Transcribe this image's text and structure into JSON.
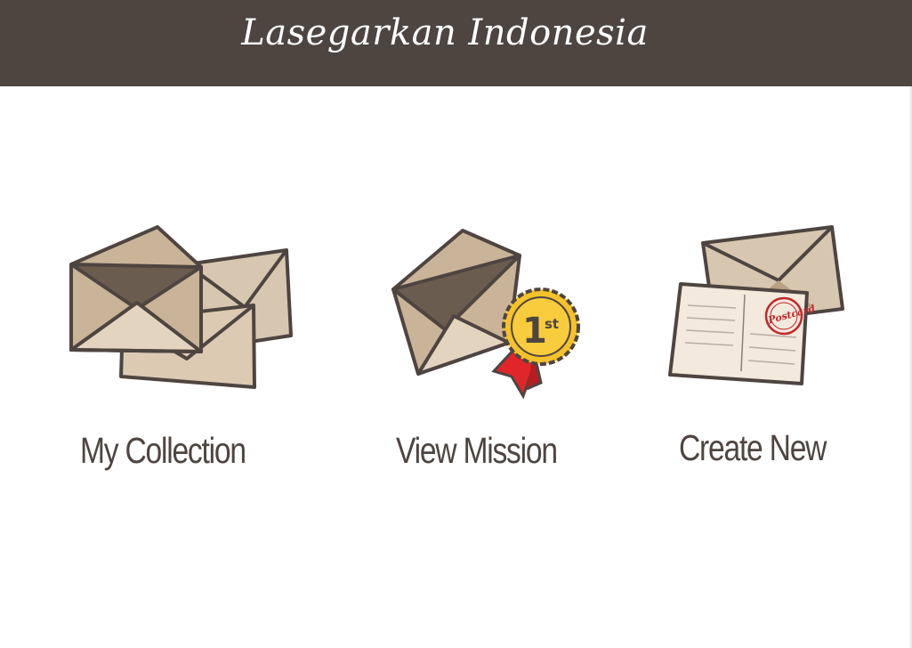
{
  "header": {
    "title": "Lasegarkan Indonesia"
  },
  "menu": [
    {
      "id": "my-collection",
      "label": "My Collection",
      "icon": "envelopes-stack-icon"
    },
    {
      "id": "view-mission",
      "label": "View Mission",
      "icon": "envelope-first-place-badge-icon"
    },
    {
      "id": "create-new",
      "label": "Create New",
      "icon": "envelope-postcard-icon"
    }
  ],
  "badge": {
    "rank_number": "1",
    "rank_suffix": "st"
  },
  "postcard": {
    "stamp_text": "Postcard"
  },
  "colors": {
    "header_bg": "#4e4541",
    "envelope": "#d8c7b0",
    "envelope_dark": "#6b5c50",
    "outline": "#4e4541",
    "badge_gold": "#f6c22b",
    "ribbon_red": "#e0262a",
    "stamp_red": "#c1272d"
  }
}
